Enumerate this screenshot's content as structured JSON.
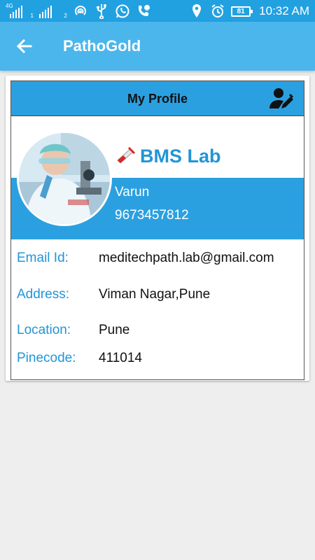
{
  "status_bar": {
    "sim1": {
      "network": "4G",
      "slot": "1"
    },
    "sim2": {
      "slot": "2"
    },
    "battery": "81",
    "time": "10:32 AM"
  },
  "app_bar": {
    "title": "PathoGold",
    "back_icon": "arrow-back-icon"
  },
  "profile": {
    "header": "My Profile",
    "edit_icon": "edit-user-icon",
    "lab_name": "BMS Lab",
    "lab_icon": "test-tube-icon",
    "person": "Varun",
    "phone": "9673457812"
  },
  "details": {
    "email": {
      "label": "Email Id:",
      "value": "meditechpath.lab@gmail.com"
    },
    "address": {
      "label": "Address:",
      "value": "Viman Nagar,Pune"
    },
    "location": {
      "label": "Location:",
      "value": "Pune"
    },
    "pincode": {
      "label": "Pinecode:",
      "value": "411014"
    }
  },
  "colors": {
    "status_bar": "#22a1e1",
    "app_bar": "#4bb6ec",
    "accent": "#2ba0e0",
    "label": "#2196d6"
  }
}
